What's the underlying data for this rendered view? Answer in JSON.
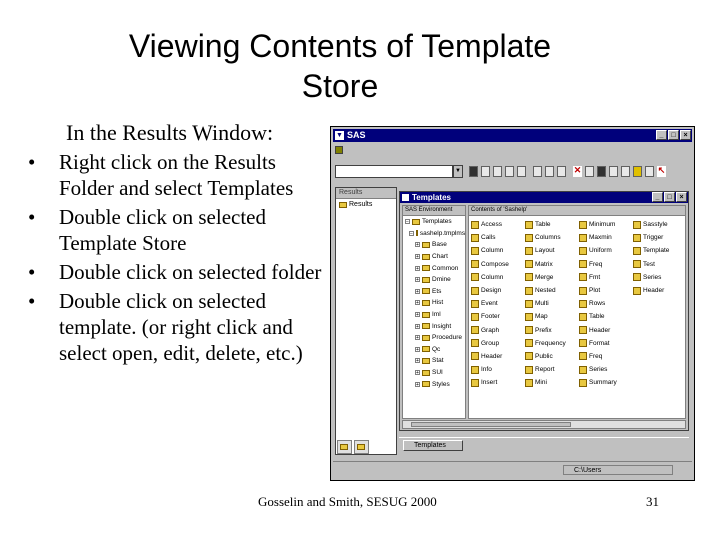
{
  "slide": {
    "title_line1": "Viewing Contents of Template",
    "title_line2": "Store",
    "intro": "In the Results Window:",
    "bullets": [
      "Right click on the Results Folder and select Templates",
      "Double click on selected Template Store",
      "Double click on selected folder",
      "Double click on selected template. (or right click and select open, edit, delete, etc.)"
    ],
    "footer": "Gosselin and Smith, SESUG 2000",
    "page_number": "31"
  },
  "sas_window": {
    "title": "SAS",
    "explorer_header": "Results",
    "explorer_item": "Results",
    "tab_results": "",
    "tab_templates": "",
    "templates_window": {
      "title": "Templates",
      "tree_header": "SAS Environment",
      "contents_header": "Contents of 'Sashelp'",
      "tree": [
        "Templates",
        "sashelp.tmplmst",
        "Base",
        "Chart",
        "Common",
        "Dmine",
        "Ets",
        "Hist",
        "Iml",
        "Insight",
        "Procedure",
        "Qc",
        "Stat",
        "SUI",
        "Styles"
      ],
      "items": [
        "Access",
        "Table",
        "Minimum",
        "Sasstyle",
        "Calls",
        "Columns",
        "Maxmin",
        "Trigger",
        "Column",
        "Layout",
        "Uniform",
        "Template",
        "Compose",
        "Matrix",
        "Freq",
        "Test",
        "Column",
        "Merge",
        "Fmt",
        "Series",
        "Design",
        "Nested",
        "Plot",
        "Header",
        "Event",
        "Multi",
        "Rows",
        "",
        "Footer",
        "Map",
        "Table",
        "",
        "Graph",
        "Prefix",
        "Header",
        "",
        "Group",
        "Frequency",
        "Format",
        "",
        "Header",
        "Public",
        "Freq",
        "",
        "Info",
        "Report",
        "Series",
        "",
        "Insert",
        "Mini",
        "Summary",
        ""
      ],
      "taskbar_label": "Templates"
    },
    "status_path": "C:\\Users"
  },
  "colors": {
    "titlebar": "#00007b",
    "folder": "#e8c840"
  }
}
